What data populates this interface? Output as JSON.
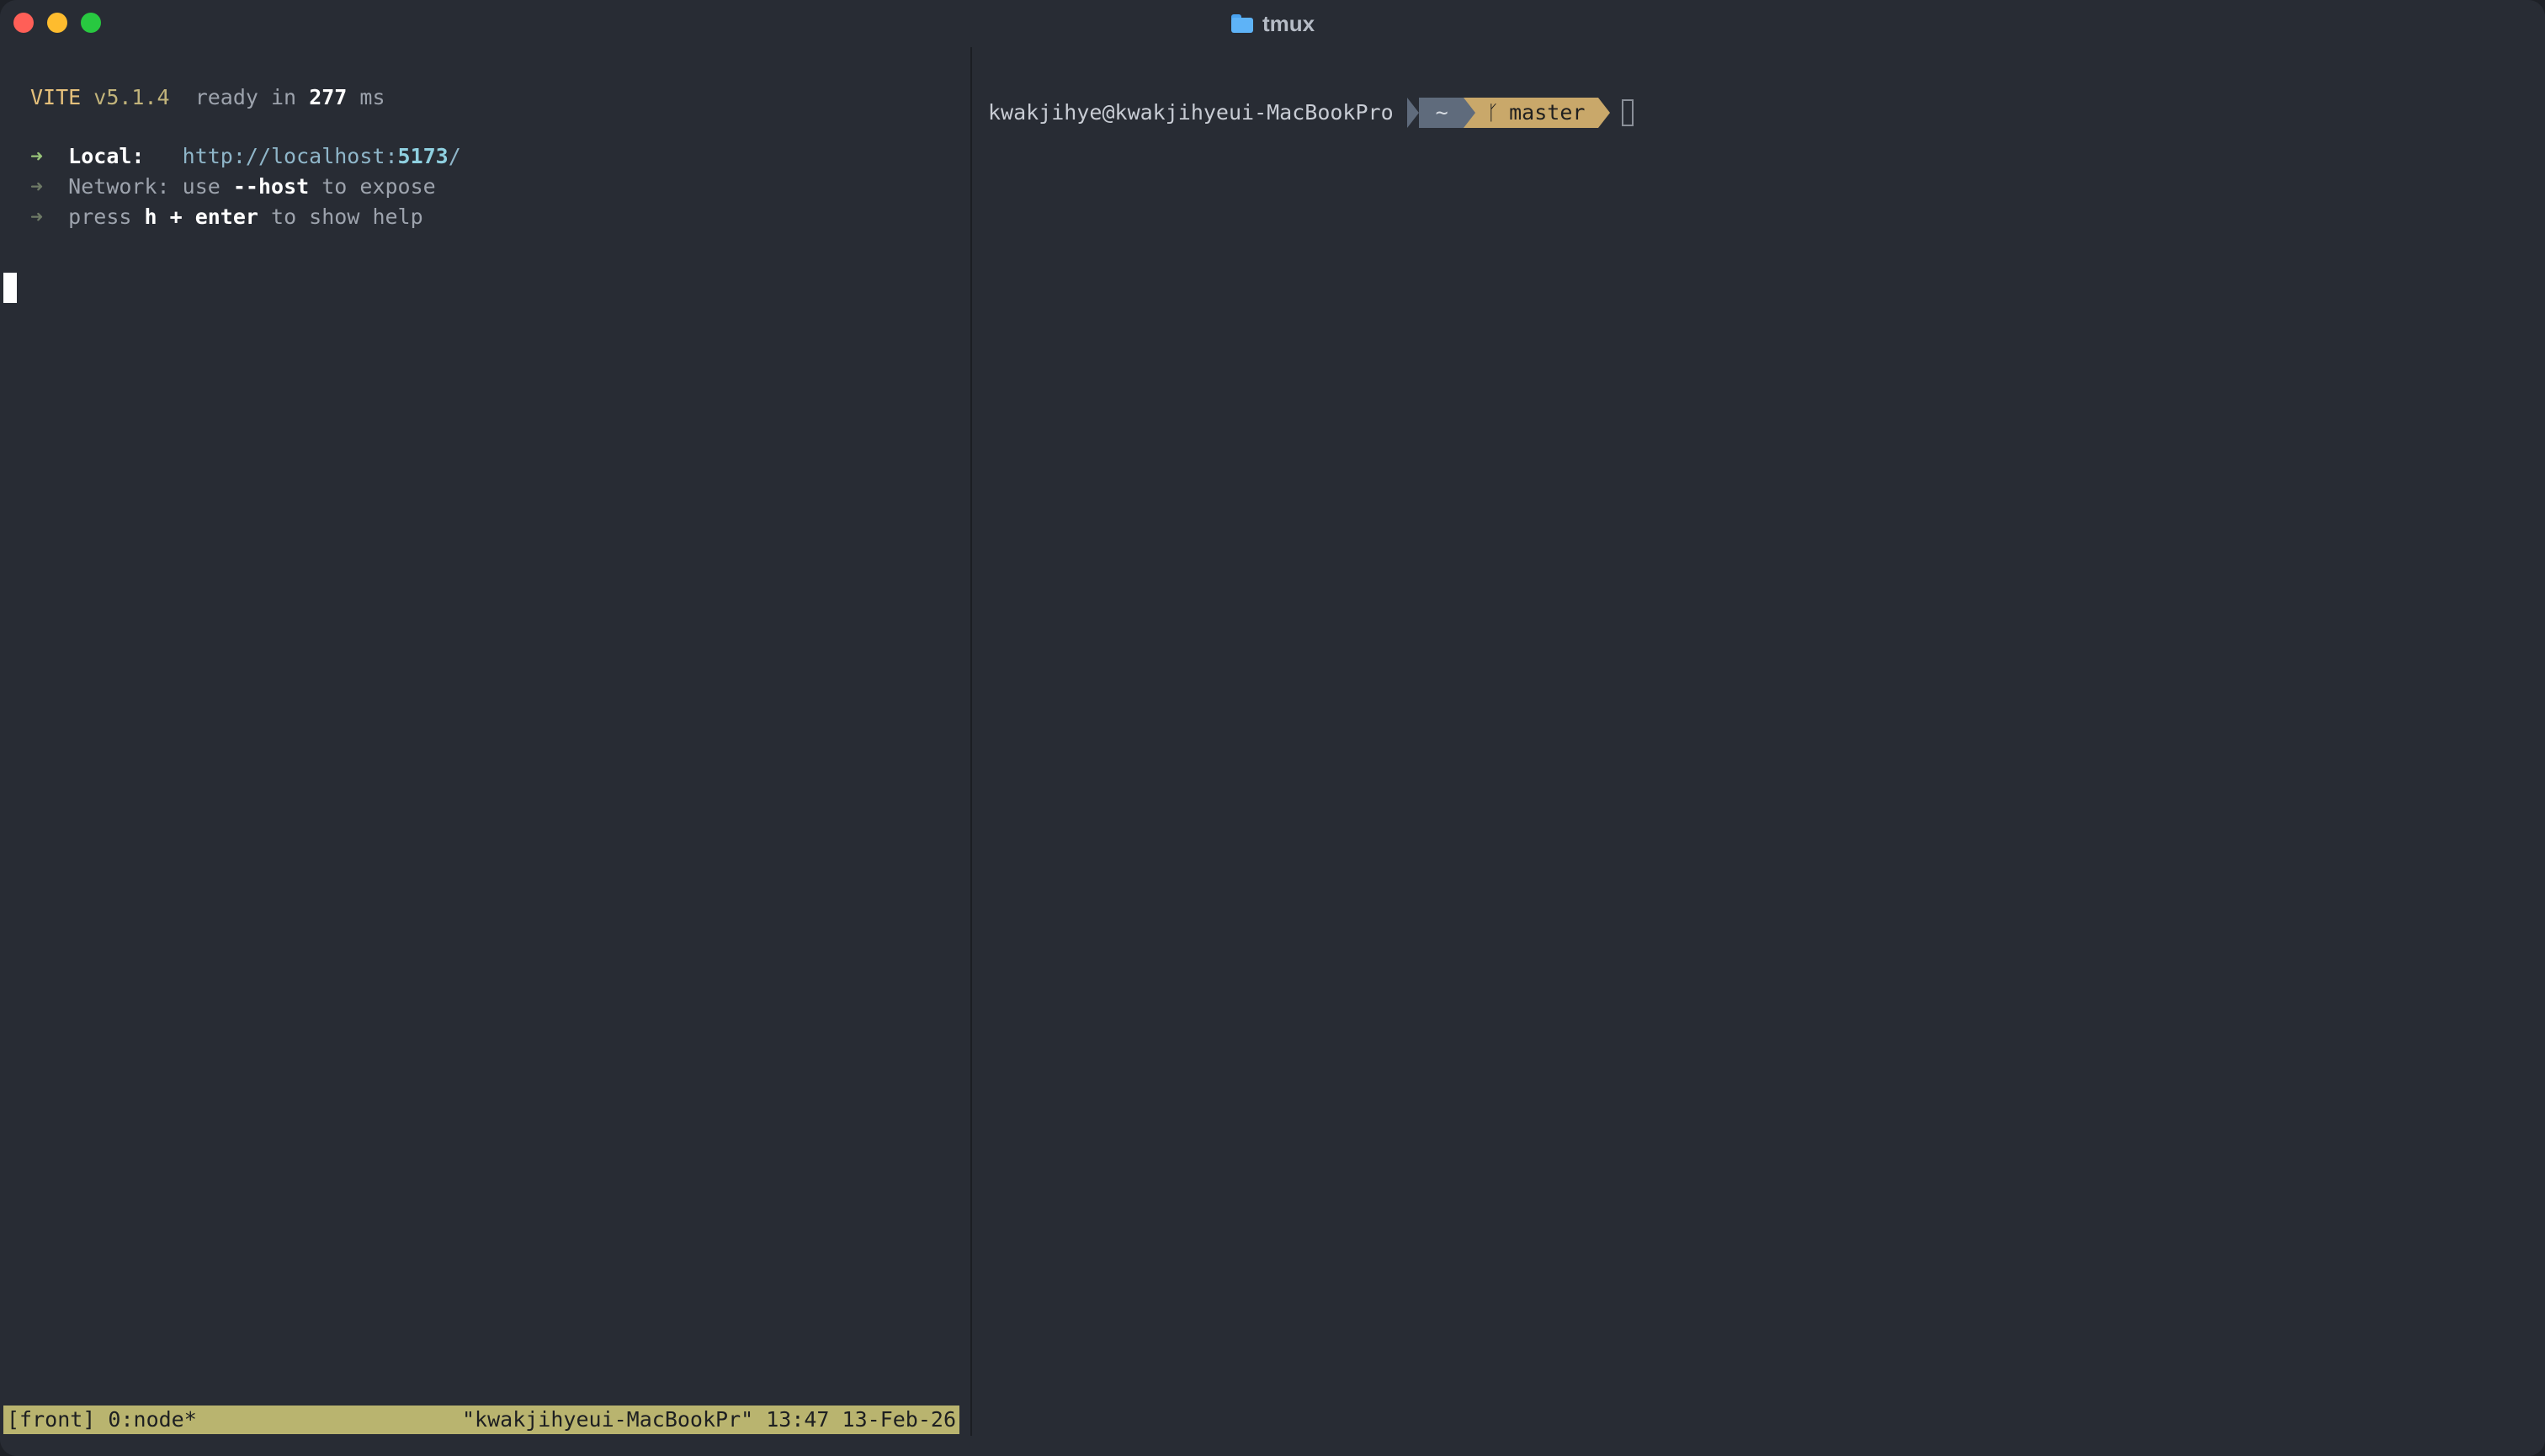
{
  "window": {
    "title": "tmux",
    "title_icon": "folder-icon"
  },
  "left_pane": {
    "vite_line": {
      "name": "VITE",
      "version": "v5.1.4",
      "ready_text": "ready in",
      "ready_ms": "277",
      "ms_unit": "ms"
    },
    "local": {
      "arrow": "➜",
      "label": "Local:",
      "url_prefix": "http://localhost:",
      "port": "5173",
      "url_suffix": "/"
    },
    "network": {
      "arrow": "➜",
      "label": "Network:",
      "pre": "use",
      "flag": "--host",
      "post": "to expose"
    },
    "help": {
      "arrow": "➜",
      "pre": "press",
      "keys": "h + enter",
      "post": "to show help"
    }
  },
  "status_bar": {
    "left": "[front] 0:node*",
    "right": "\"kwakjihyeui-MacBookPr\" 13:47 13-Feb-26"
  },
  "right_pane": {
    "prompt_user": "kwakjihye@kwakjihyeui-MacBookPro",
    "prompt_dir": "~",
    "branch_icon": "git-branch-icon",
    "branch_glyph": "ᚴ",
    "branch": "master"
  },
  "colors": {
    "background": "#282c34",
    "status_bar": "#b9b46f",
    "prompt_dir_bg": "#5f6b7c",
    "prompt_branch_bg": "#c9a86a",
    "vite_yellow": "#e5c07b",
    "arrow_green": "#98c379"
  }
}
